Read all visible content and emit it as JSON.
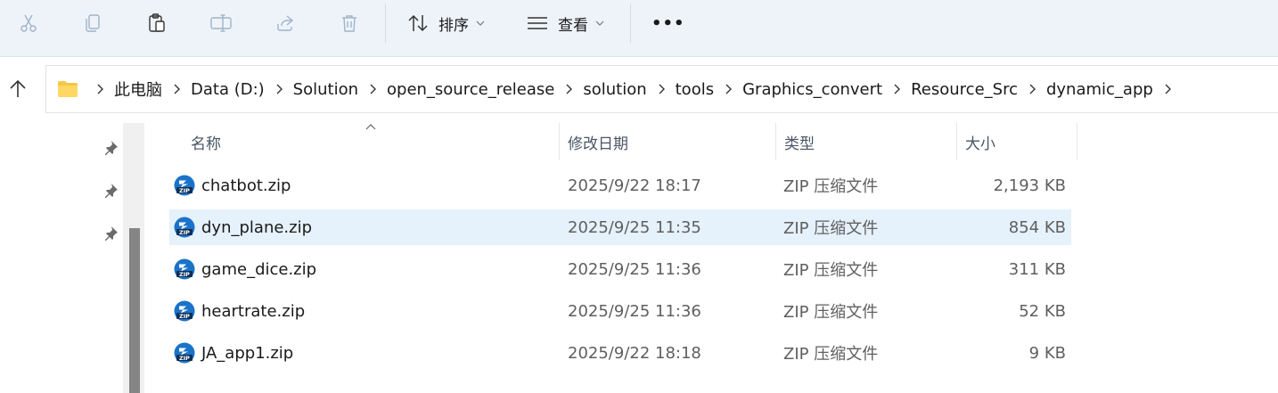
{
  "toolbar": {
    "buttons": [
      {
        "name": "cut",
        "icon": "scissors-icon"
      },
      {
        "name": "copy",
        "icon": "copy-icon"
      },
      {
        "name": "paste",
        "icon": "paste-icon"
      },
      {
        "name": "rename",
        "icon": "rename-icon"
      },
      {
        "name": "share",
        "icon": "share-icon"
      },
      {
        "name": "delete",
        "icon": "trash-icon"
      }
    ],
    "sort_label": "排序",
    "view_label": "查看",
    "more_label": "•••"
  },
  "address": {
    "breadcrumbs": [
      "此电脑",
      "Data (D:)",
      "Solution",
      "open_source_release",
      "solution",
      "tools",
      "Graphics_convert",
      "Resource_Src",
      "dynamic_app"
    ]
  },
  "list": {
    "columns": {
      "name": "名称",
      "date": "修改日期",
      "type": "类型",
      "size": "大小"
    },
    "rows": [
      {
        "name": "chatbot.zip",
        "date": "2025/9/22 18:17",
        "type": "ZIP 压缩文件",
        "size": "2,193 KB",
        "selected": false
      },
      {
        "name": "dyn_plane.zip",
        "date": "2025/9/25 11:35",
        "type": "ZIP 压缩文件",
        "size": "854 KB",
        "selected": true
      },
      {
        "name": "game_dice.zip",
        "date": "2025/9/25 11:36",
        "type": "ZIP 压缩文件",
        "size": "311 KB",
        "selected": false
      },
      {
        "name": "heartrate.zip",
        "date": "2025/9/25 11:36",
        "type": "ZIP 压缩文件",
        "size": "52 KB",
        "selected": false
      },
      {
        "name": "JA_app1.zip",
        "date": "2025/9/22 18:18",
        "type": "ZIP 压缩文件",
        "size": "9 KB",
        "selected": false
      }
    ]
  },
  "colors": {
    "toolbar_bg": "#eef3fa",
    "selected_row": "#e5f1fb",
    "zip_icon_blue": "#1a73c9",
    "folder_yellow": "#f6c744"
  }
}
